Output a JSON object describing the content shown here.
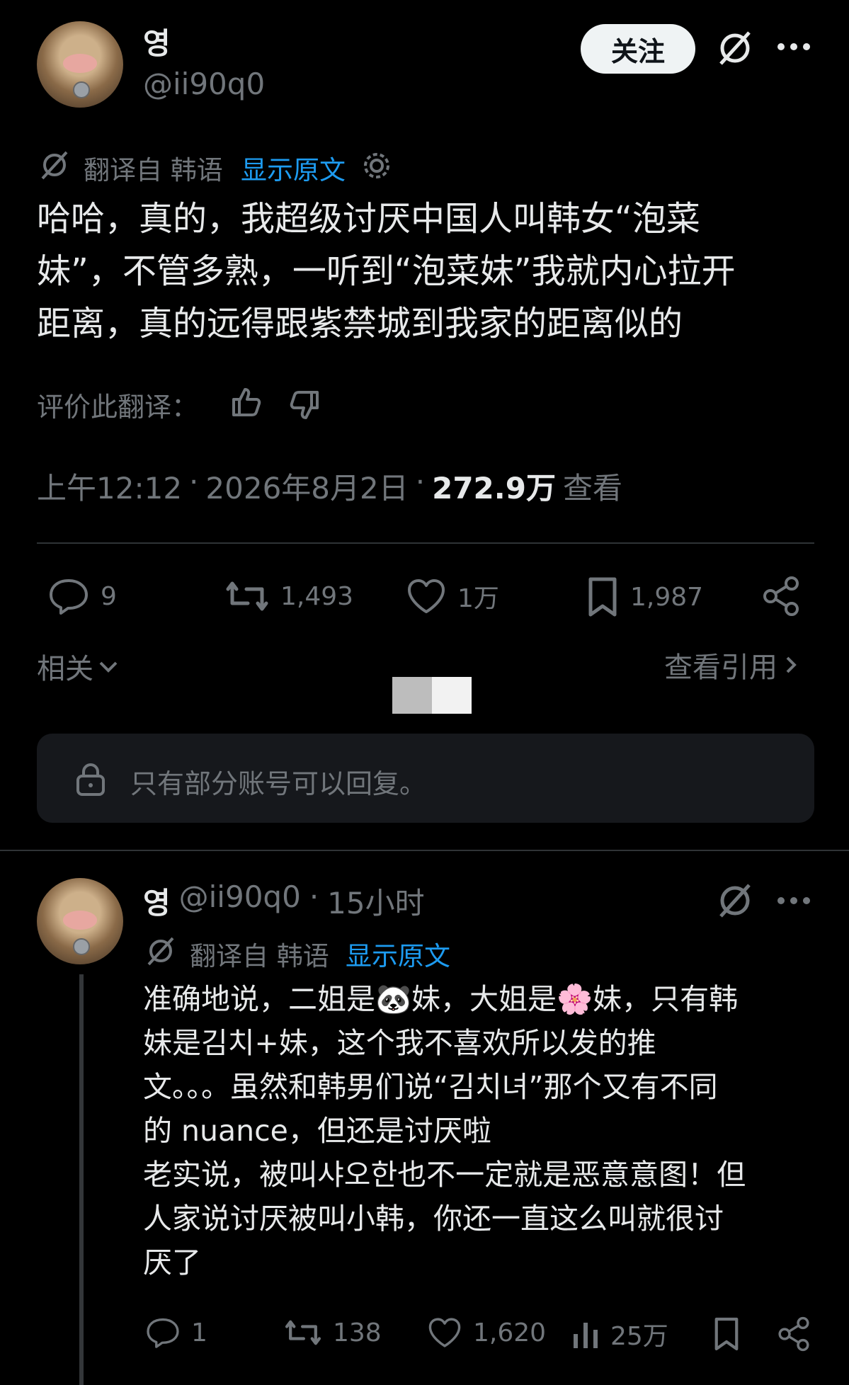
{
  "post": {
    "display_name": "영",
    "handle": "@ii90q0",
    "follow_label": "关注",
    "translated_from": "翻译自 韩语",
    "show_original": "显示原文",
    "text_lines": [
      "哈哈，真的，我超级讨厌中国人叫韩女“泡菜",
      "妹”，不管多熟，一听到“泡菜妹”我就内心拉开",
      "距离，真的远得跟紫禁城到我家的距离似的"
    ],
    "rate_translation": "评价此翻译：",
    "time": "上午12:12",
    "date": "2026年8月2日",
    "views_count": "272.9万",
    "views_label": "查看",
    "stats": {
      "replies": "9",
      "reposts": "1,493",
      "likes": "1万",
      "bookmarks": "1,987"
    },
    "related_label": "相关",
    "view_quotes_label": "查看引用",
    "reply_restriction": "只有部分账号可以回复。"
  },
  "reply": {
    "display_name": "영",
    "handle": "@ii90q0",
    "time_ago": "15小时",
    "translated_from": "翻译自 韩语",
    "show_original": "显示原文",
    "text_lines": [
      "准确地说，二姐是🐼妹，大姐是🌸妹，只有韩",
      "妹是김치+妹，这个我不喜欢所以发的推",
      "文。。。虽然和韩男们说“김치녀”那个又有不同",
      "的 nuance，但还是讨厌啦",
      "老实说，被叫샤오한也不一定就是恶意意图！但",
      "人家说讨厌被叫小韩，你还一直这么叫就很讨",
      "厌了"
    ],
    "stats": {
      "replies": "1",
      "reposts": "138",
      "likes": "1,620",
      "views": "25万"
    }
  },
  "colors": {
    "background": "#000000",
    "text": "#e7e9ea",
    "muted": "#71767b",
    "link": "#1d9bf0",
    "divider": "#2f3336"
  }
}
